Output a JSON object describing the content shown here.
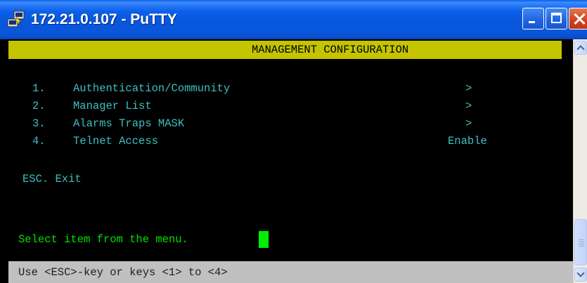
{
  "window": {
    "title": "172.21.0.107 - PuTTY",
    "icon": "putty-icon",
    "buttons": [
      "minimize-icon",
      "maximize-icon",
      "close-icon"
    ]
  },
  "terminal": {
    "header": "MANAGEMENT CONFIGURATION",
    "menu": [
      {
        "num": "1.",
        "label": "Authentication/Community",
        "value": ">"
      },
      {
        "num": "2.",
        "label": "Manager List",
        "value": ">"
      },
      {
        "num": "3.",
        "label": "Alarms Traps MASK",
        "value": ">"
      },
      {
        "num": "4.",
        "label": "Telnet Access",
        "value": "Enable"
      }
    ],
    "exit": "ESC. Exit",
    "prompt": "Select item from the menu.",
    "status": "Use <ESC>-key or keys <1> to <4>"
  },
  "colors": {
    "header_bg": "#c4c400",
    "menu_text": "#3fbfbf",
    "prompt_text": "#00e000",
    "cursor": "#00ee00",
    "status_bg": "#c0c0c0"
  }
}
